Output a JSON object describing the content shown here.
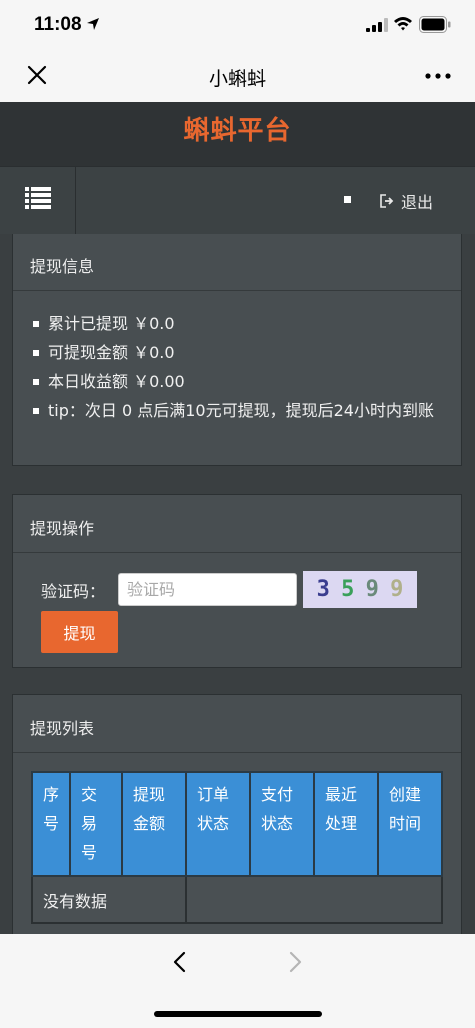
{
  "status_bar": {
    "time": "11:08"
  },
  "navbar": {
    "title": "小蝌蚪"
  },
  "brand": {
    "title": "蝌蚪平台"
  },
  "toolbar": {
    "logout_label": "退出"
  },
  "info_panel": {
    "title": "提现信息",
    "items": [
      "累计已提现 ￥0.0",
      "可提现金额 ￥0.0",
      "本日收益额 ￥0.00",
      "tip：次日 0 点后满10元可提现，提现后24小时内到账"
    ]
  },
  "op_panel": {
    "title": "提现操作",
    "captcha_label": "验证码：",
    "captcha_placeholder": "验证码",
    "captcha_digits": [
      "3",
      "5",
      "9",
      "9"
    ],
    "withdraw_label": "提现"
  },
  "list_panel": {
    "title": "提现列表",
    "columns": [
      "序号",
      "交易号",
      "提现金额",
      "订单状态",
      "支付状态",
      "最近处理",
      "创建时间"
    ],
    "empty_text": "没有数据"
  },
  "colors": {
    "accent": "#e8672f",
    "table_header": "#3b8fd6",
    "panel": "#484e51"
  }
}
